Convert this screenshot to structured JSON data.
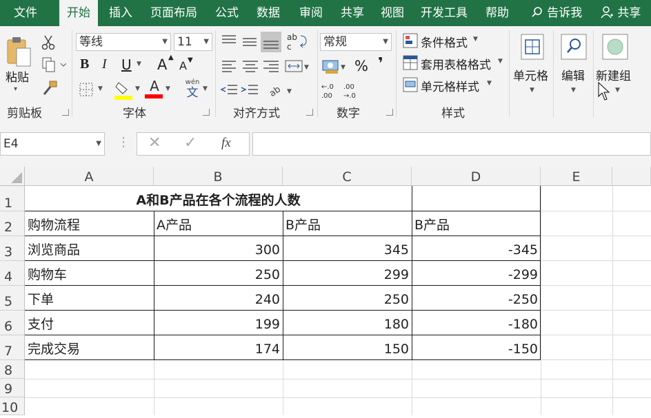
{
  "tabs": [
    "文件",
    "开始",
    "插入",
    "页面布局",
    "公式",
    "数据",
    "审阅",
    "共享",
    "视图",
    "开发工具",
    "帮助",
    "告诉我",
    "共享"
  ],
  "ribbon": {
    "paste_label": "粘贴",
    "clipboard_label": "剪贴板",
    "font_name": "等线",
    "font_size": "11",
    "font_label": "字体",
    "align_label": "对齐方式",
    "number_format": "常规",
    "number_label": "数字",
    "cond_format": "条件格式",
    "table_format": "套用表格格式",
    "cell_style": "单元格样式",
    "styles_label": "样式",
    "cells_label": "单元格",
    "edit_label": "编辑",
    "newgroup_label": "新建组",
    "bold": "B",
    "italic": "I",
    "underline": "U",
    "grow_font": "A",
    "shrink_font": "A",
    "phonetic": "wén",
    "phonetic_char": "文",
    "percent": "%",
    "comma": "❜",
    "fill_colors": {
      "fill": "#ffff00",
      "font": "#ff0000"
    }
  },
  "formula_bar": {
    "name_box": "E4",
    "fx": "fx",
    "value": ""
  },
  "columns": [
    "A",
    "B",
    "C",
    "D",
    "E"
  ],
  "rows": [
    "1",
    "2",
    "3",
    "4",
    "5",
    "6",
    "7",
    "8",
    "9",
    "10"
  ],
  "sheet": {
    "title": "A和B产品在各个流程的人数",
    "headers": [
      "购物流程",
      "A产品",
      "B产品",
      "B产品"
    ],
    "data": [
      [
        "浏览商品",
        "300",
        "345",
        "-345"
      ],
      [
        "购物车",
        "250",
        "299",
        "-299"
      ],
      [
        "下单",
        "240",
        "250",
        "-250"
      ],
      [
        "支付",
        "199",
        "180",
        "-180"
      ],
      [
        "完成交易",
        "174",
        "150",
        "-150"
      ]
    ]
  }
}
